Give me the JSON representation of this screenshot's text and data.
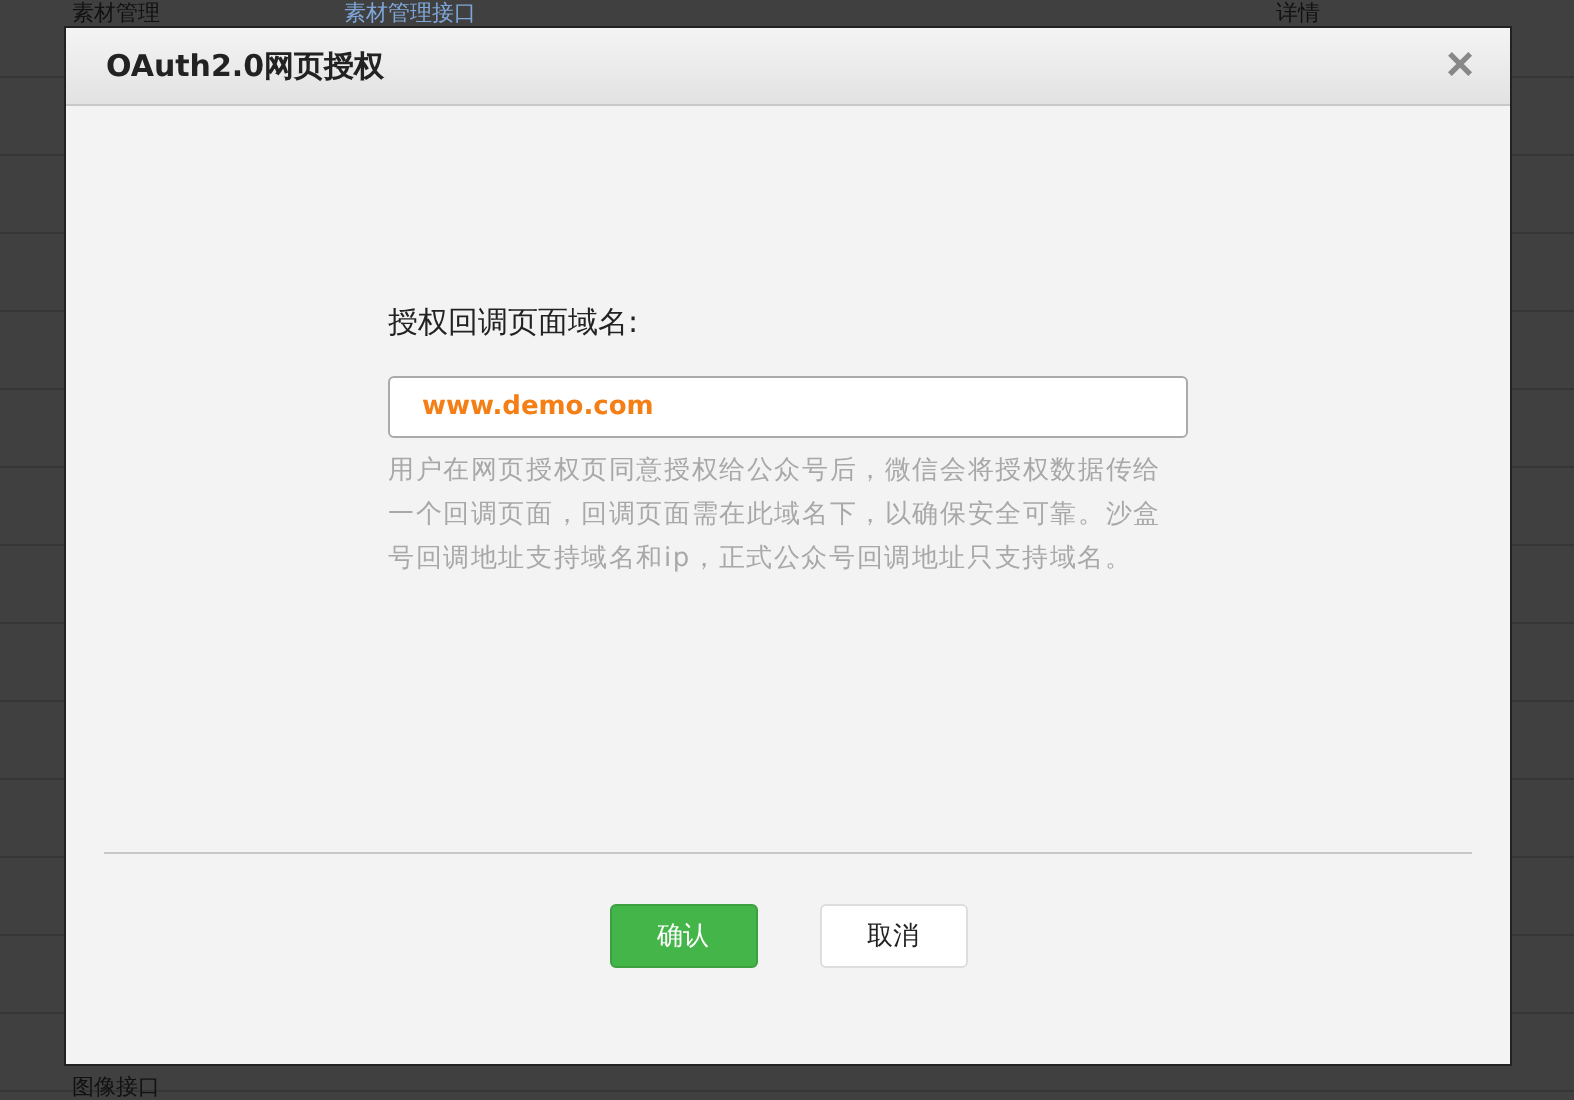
{
  "background_table": {
    "top_row": {
      "name": "素材管理",
      "link": "素材管理接口",
      "action": "详情"
    },
    "bottom_row": {
      "name": "图像接口"
    }
  },
  "dialog": {
    "title": "OAuth2.0网页授权",
    "close": "×",
    "field": {
      "label": "授权回调页面域名:",
      "value": "www.demo.com"
    },
    "help": "用户在网页授权页同意授权给公众号后，微信会将授权数据传给一个回调页面，回调页面需在此域名下，以确保安全可靠。沙盒号回调地址支持域名和ip，正式公众号回调地址只支持域名。",
    "buttons": [
      {
        "label": "确认",
        "kind": "primary"
      },
      {
        "label": "取消",
        "kind": "secondary"
      }
    ]
  }
}
